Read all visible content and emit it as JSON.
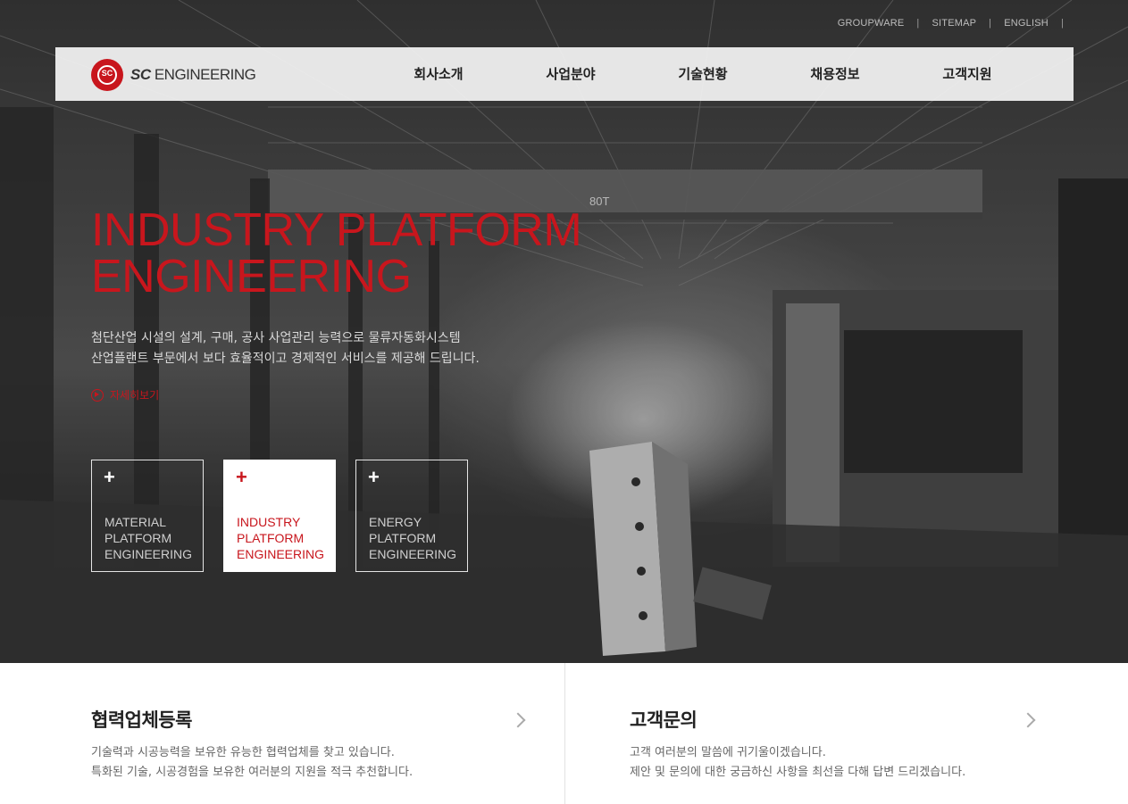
{
  "util_links": [
    "GROUPWARE",
    "SITEMAP",
    "ENGLISH"
  ],
  "logo": {
    "mark_text": "SC",
    "brand": "SC",
    "brand_rest": " ENGINEERING"
  },
  "menu": [
    "회사소개",
    "사업분야",
    "기술현황",
    "채용정보",
    "고객지원"
  ],
  "hero": {
    "title_line1": "INDUSTRY PLATFORM",
    "title_line2": "ENGINEERING",
    "desc_line1": "첨단산업 시설의 설계, 구매, 공사 사업관리 능력으로 물류자동화시스템",
    "desc_line2": "산업플랜트 부문에서 보다 효율적이고 경제적인 서비스를 제공해 드립니다.",
    "more": "자세히보기",
    "crane_label": "80T"
  },
  "tiles": [
    {
      "plus": "+",
      "line1": "MATERIAL",
      "line2": "PLATFORM",
      "line3": "ENGINEERING",
      "active": false
    },
    {
      "plus": "+",
      "line1": "INDUSTRY",
      "line2": "PLATFORM",
      "line3": "ENGINEERING",
      "active": true
    },
    {
      "plus": "+",
      "line1": "ENERGY",
      "line2": "PLATFORM",
      "line3": "ENGINEERING",
      "active": false
    }
  ],
  "panels": [
    {
      "title": "협력업체등록",
      "line1": "기술력과 시공능력을 보유한 유능한 협력업체를 찾고 있습니다.",
      "line2": "특화된 기술, 시공경험을 보유한 여러분의 지원을 적극 추천합니다."
    },
    {
      "title": "고객문의",
      "line1": "고객 여러분의 말씀에 귀기울이겠습니다.",
      "line2": "제안 및 문의에 대한 궁금하신 사항을 최선을 다해 답변 드리겠습니다."
    }
  ],
  "colors": {
    "accent": "#c8161d",
    "nav_bg": "#f0f0f0"
  }
}
